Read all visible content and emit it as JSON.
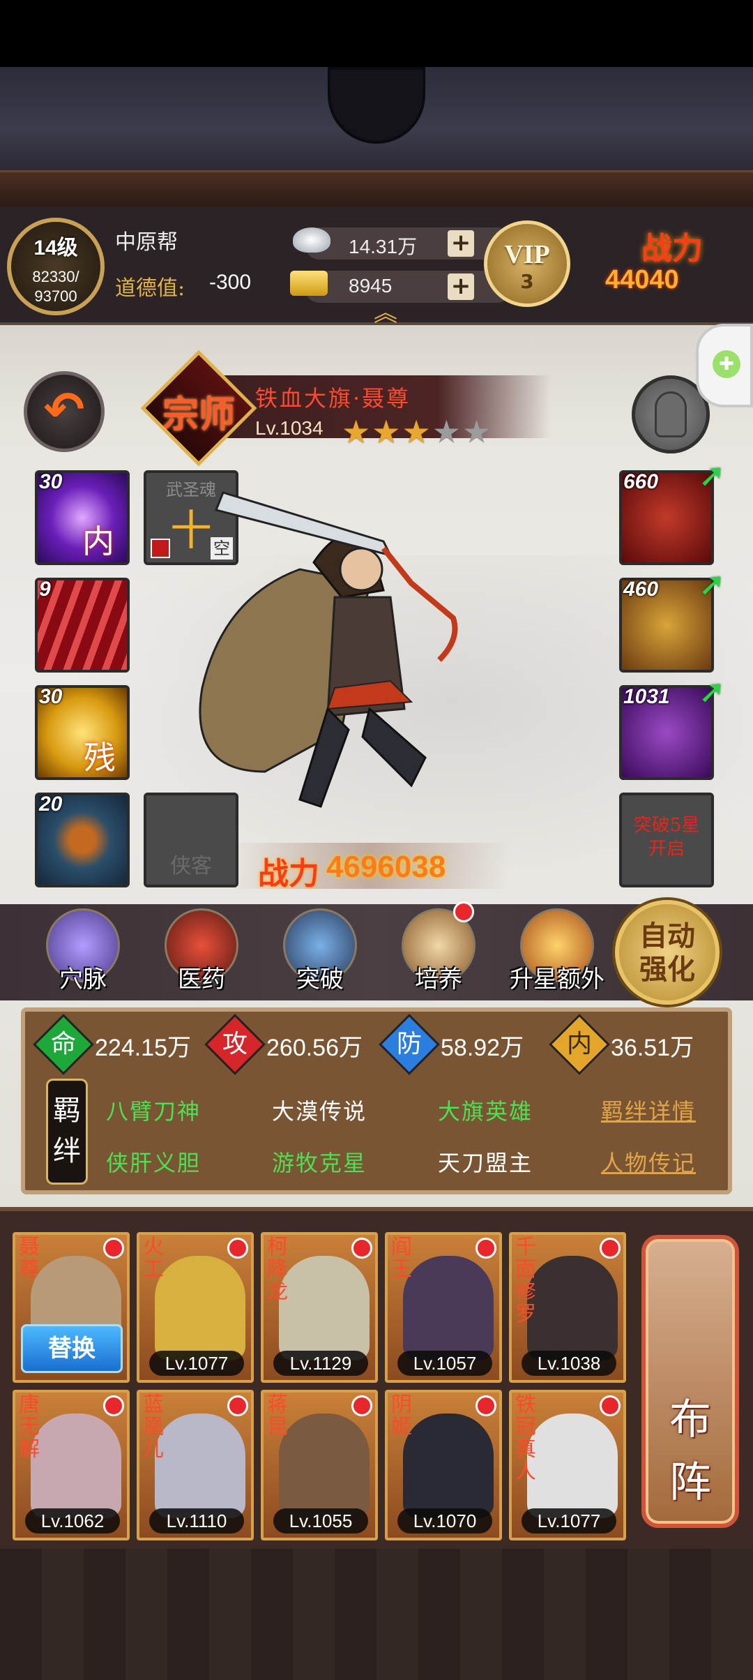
{
  "topbar": {
    "level": "14级",
    "exp_current": "82330/",
    "exp_max": "93700",
    "guild": "中原帮",
    "morality_label": "道德值:",
    "morality_value": "-300",
    "silver": "14.31万",
    "gold": "8945",
    "vip_label": "VIP",
    "vip_level": "3",
    "power_label": "战力",
    "power_value": "44040"
  },
  "hero": {
    "rank": "宗师",
    "name": "铁血大旗·聂尊",
    "level": "Lv.1034",
    "stars": 3,
    "stars_max": 5,
    "power_label": "战力",
    "power_value": "4696038"
  },
  "left_slots": [
    {
      "num": "30",
      "glyph": "内",
      "color": "#6a1fb8"
    },
    {
      "num": "9",
      "glyph": "",
      "color": "#b8141c"
    },
    {
      "num": "30",
      "glyph": "残",
      "color": "#d89a10"
    },
    {
      "num": "20",
      "glyph": "",
      "color": "#2a4e6a"
    }
  ],
  "soul_slot": {
    "title": "武圣魂",
    "glyph": "十",
    "tag": "空"
  },
  "follower_slot": {
    "label": "侠客"
  },
  "right_slots": [
    {
      "num": "660"
    },
    {
      "num": "460"
    },
    {
      "num": "1031"
    }
  ],
  "breakthrough_slot": {
    "text": "突破5星开启"
  },
  "menu": [
    {
      "label": "穴脉"
    },
    {
      "label": "医药"
    },
    {
      "label": "突破"
    },
    {
      "label": "培养"
    },
    {
      "label": "升星额外"
    }
  ],
  "auto_strengthen": {
    "line1": "自动",
    "line2": "强化"
  },
  "attributes": [
    {
      "icon": "命",
      "value": "224.15万",
      "color": "#1ea83a"
    },
    {
      "icon": "攻",
      "value": "260.56万",
      "color": "#d6262a"
    },
    {
      "icon": "防",
      "value": "58.92万",
      "color": "#2b7de0"
    },
    {
      "icon": "内",
      "value": "36.51万",
      "color": "#e3a52a"
    }
  ],
  "bond": {
    "tag": "羁绊",
    "row1": [
      "八臂刀神",
      "大漠传说",
      "大旗英雄"
    ],
    "row2": [
      "侠肝义胆",
      "游牧克星",
      "天刀盟主"
    ],
    "detail_link": "羁绊详情",
    "biography_link": "人物传记"
  },
  "roster_row1": [
    {
      "name": "聂尊",
      "level": "",
      "replace": "替换"
    },
    {
      "name": "火工",
      "level": "Lv.1077"
    },
    {
      "name": "柯降龙",
      "level": "Lv.1129"
    },
    {
      "name": "阎王",
      "level": "Lv.1057"
    },
    {
      "name": "千面修罗",
      "level": "Lv.1038"
    }
  ],
  "roster_row2": [
    {
      "name": "唐无解",
      "level": "Lv.1062"
    },
    {
      "name": "蓝凰儿",
      "level": "Lv.1110"
    },
    {
      "name": "蒋昆",
      "level": "Lv.1055"
    },
    {
      "name": "阴姬",
      "level": "Lv.1070"
    },
    {
      "name": "铁冠真人",
      "level": "Lv.1077"
    }
  ],
  "formation": {
    "line1": "布",
    "line2": "阵"
  }
}
